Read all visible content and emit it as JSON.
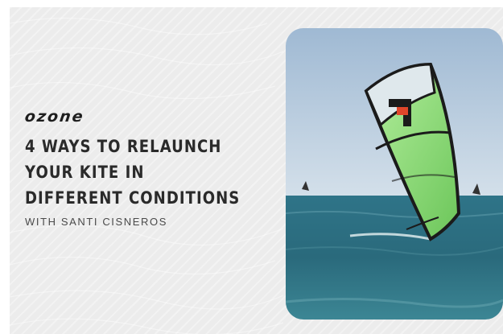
{
  "brand": {
    "logo_text": "OZONE"
  },
  "headline": {
    "lines": [
      "4 WAYS TO RELAUNCH",
      "YOUR KITE IN",
      "DIFFERENT CONDITIONS"
    ]
  },
  "byline": "WITH SANTI CISNEROS",
  "colors": {
    "background": "#ececec",
    "text": "#2a2a2a",
    "sky": "#b9cde0",
    "sea": "#2a6f85",
    "kite_green": "#8fe07a",
    "kite_red": "#e0462a"
  },
  "photo": {
    "subject": "kite-over-sea-photo"
  }
}
